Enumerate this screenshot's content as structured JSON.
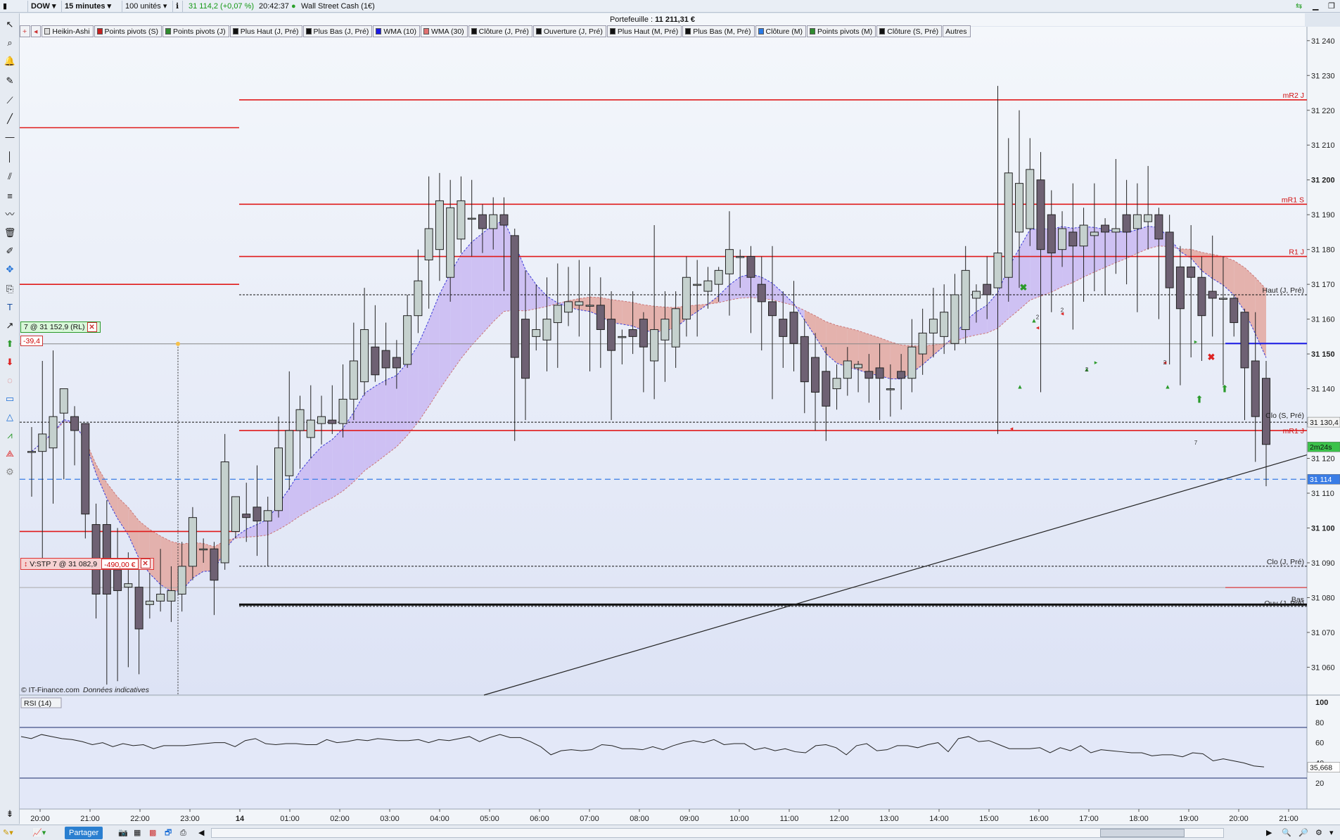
{
  "topbar": {
    "symbol": "DOW",
    "timeframe": "15 minutes",
    "quantity": "100 unités",
    "price": "31 114,2 (+0,07 %)",
    "time": "20:42:37",
    "instrument": "Wall Street Cash (1€)"
  },
  "portfolio": {
    "label": "Portefeuille :",
    "value": "11 211,31 €"
  },
  "indicators": [
    {
      "label": "Heikin-Ashi",
      "color": "#dddddd"
    },
    {
      "label": "Points pivots (S)",
      "color": "#c62020"
    },
    {
      "label": "Points pivots (J)",
      "color": "#2e8b2e"
    },
    {
      "label": "Plus Haut (J, Pré)",
      "color": "#111111"
    },
    {
      "label": "Plus Bas (J, Pré)",
      "color": "#111111"
    },
    {
      "label": "WMA (10)",
      "color": "#1a1ae6"
    },
    {
      "label": "WMA (30)",
      "color": "#e07070"
    },
    {
      "label": "Clôture (J, Pré)",
      "color": "#111111"
    },
    {
      "label": "Ouverture (J, Pré)",
      "color": "#111111"
    },
    {
      "label": "Plus Haut (M, Pré)",
      "color": "#111111"
    },
    {
      "label": "Plus Bas (M, Pré)",
      "color": "#111111"
    },
    {
      "label": "Clôture (M)",
      "color": "#2a7ae6"
    },
    {
      "label": "Points pivots (M)",
      "color": "#2e8b2e"
    },
    {
      "label": "Clôture (S, Pré)",
      "color": "#111111"
    },
    {
      "label": "Autres",
      "color": ""
    }
  ],
  "order": {
    "label": "7 @ 31 152,9 (RL)",
    "pnl": "-39,4"
  },
  "stop": {
    "label": "V:STP 7 @ 31 082,9",
    "value": "-490,00 €"
  },
  "copyright": "© IT-Finance.com",
  "disclaimer": "Données indicatives",
  "rsi": {
    "label": "RSI (14)",
    "value": "35,668",
    "ticks": [
      "100",
      "80",
      "60",
      "40",
      "20"
    ]
  },
  "price_labels": {
    "last": "31 114",
    "clo_s": "31 130,4",
    "countdown": "2m24s"
  },
  "level_labels": [
    "mR2 J",
    "mR1 S",
    "R1 J",
    "Haut (J, Pré)",
    "Clo (S, Pré)",
    "mR1 J",
    "Clo (J, Pré)",
    "Ouv (J, Pré)",
    "Bas"
  ],
  "marker_labels": [
    "2",
    "2",
    "2",
    "2",
    "7"
  ],
  "bottombar": {
    "share": "Partager"
  },
  "colors": {
    "bull": "#c5d1ce",
    "bear": "#6e6173",
    "wma10": "#3b3bd8",
    "up_fill": "#c9b8f2",
    "down_fill": "#e3a7a0",
    "red_level": "#e01a1a",
    "bg": "#e8eef8"
  },
  "chart_data": {
    "type": "candlestick",
    "x_ticks": [
      "20:00",
      "21:00",
      "22:00",
      "23:00",
      "14",
      "01:00",
      "02:00",
      "03:00",
      "04:00",
      "05:00",
      "06:00",
      "07:00",
      "08:00",
      "09:00",
      "10:00",
      "11:00",
      "12:00",
      "13:00",
      "14:00",
      "15:00",
      "16:00",
      "17:00",
      "18:00",
      "19:00",
      "20:00",
      "21:00"
    ],
    "y_ticks": [
      31060,
      31070,
      31080,
      31090,
      31100,
      31110,
      31120,
      31130,
      31140,
      31150,
      31160,
      31170,
      31180,
      31190,
      31200,
      31210,
      31220,
      31230,
      31240
    ],
    "ylim": [
      31052,
      31244
    ],
    "candles": [
      {
        "t": "19:45",
        "o": 31122,
        "h": 31129,
        "l": 31109,
        "c": 31122
      },
      {
        "t": "20:00",
        "o": 31122,
        "h": 31148,
        "l": 31090,
        "c": 31127
      },
      {
        "t": "20:15",
        "o": 31123,
        "h": 31151,
        "l": 31107,
        "c": 31132
      },
      {
        "t": "20:30",
        "o": 31133,
        "h": 31140,
        "l": 31114,
        "c": 31140
      },
      {
        "t": "20:45",
        "o": 31132,
        "h": 31135,
        "l": 31118,
        "c": 31128
      },
      {
        "t": "21:00",
        "o": 31130,
        "h": 31130,
        "l": 31097,
        "c": 31104
      },
      {
        "t": "21:15",
        "o": 31101,
        "h": 31107,
        "l": 31074,
        "c": 31081
      },
      {
        "t": "21:30",
        "o": 31101,
        "h": 31108,
        "l": 31055,
        "c": 31081
      },
      {
        "t": "21:45",
        "o": 31088,
        "h": 31100,
        "l": 31056,
        "c": 31082
      },
      {
        "t": "22:00",
        "o": 31083,
        "h": 31093,
        "l": 31060,
        "c": 31084
      },
      {
        "t": "22:15",
        "o": 31083,
        "h": 31091,
        "l": 31058,
        "c": 31071
      },
      {
        "t": "22:30",
        "o": 31078,
        "h": 31087,
        "l": 31074,
        "c": 31079
      },
      {
        "t": "22:45",
        "o": 31079,
        "h": 31094,
        "l": 31076,
        "c": 31081
      },
      {
        "t": "23:00",
        "o": 31079,
        "h": 31089,
        "l": 31073,
        "c": 31082
      },
      {
        "t": "23:15",
        "o": 31081,
        "h": 31096,
        "l": 31076,
        "c": 31089
      },
      {
        "t": "23:30",
        "o": 31089,
        "h": 31106,
        "l": 31085,
        "c": 31103
      },
      {
        "t": "23:45",
        "o": 31094,
        "h": 31097,
        "l": 31090,
        "c": 31094
      },
      {
        "t": "00:00",
        "o": 31094,
        "h": 31096,
        "l": 31075,
        "c": 31085
      },
      {
        "t": "00:15",
        "o": 31090,
        "h": 31127,
        "l": 31088,
        "c": 31119
      },
      {
        "t": "00:30",
        "o": 31099,
        "h": 31109,
        "l": 31097,
        "c": 31109
      },
      {
        "t": "00:45",
        "o": 31104,
        "h": 31113,
        "l": 31096,
        "c": 31103
      },
      {
        "t": "01:00",
        "o": 31106,
        "h": 31118,
        "l": 31092,
        "c": 31102
      },
      {
        "t": "01:15",
        "o": 31102,
        "h": 31109,
        "l": 31089,
        "c": 31105
      },
      {
        "t": "01:30",
        "o": 31105,
        "h": 31132,
        "l": 31103,
        "c": 31123
      },
      {
        "t": "01:45",
        "o": 31115,
        "h": 31145,
        "l": 31111,
        "c": 31128
      },
      {
        "t": "02:00",
        "o": 31128,
        "h": 31138,
        "l": 31117,
        "c": 31134
      },
      {
        "t": "02:15",
        "o": 31126,
        "h": 31141,
        "l": 31120,
        "c": 31131
      },
      {
        "t": "02:30",
        "o": 31130,
        "h": 31138,
        "l": 31124,
        "c": 31132
      },
      {
        "t": "02:45",
        "o": 31131,
        "h": 31141,
        "l": 31127,
        "c": 31130
      },
      {
        "t": "03:00",
        "o": 31130,
        "h": 31147,
        "l": 31126,
        "c": 31137
      },
      {
        "t": "03:15",
        "o": 31137,
        "h": 31159,
        "l": 31131,
        "c": 31148
      },
      {
        "t": "03:30",
        "o": 31142,
        "h": 31169,
        "l": 31138,
        "c": 31157
      },
      {
        "t": "03:45",
        "o": 31152,
        "h": 31164,
        "l": 31142,
        "c": 31144
      },
      {
        "t": "04:00",
        "o": 31151,
        "h": 31159,
        "l": 31141,
        "c": 31146
      },
      {
        "t": "04:15",
        "o": 31149,
        "h": 31154,
        "l": 31140,
        "c": 31146
      },
      {
        "t": "04:30",
        "o": 31147,
        "h": 31167,
        "l": 31146,
        "c": 31161
      },
      {
        "t": "04:45",
        "o": 31161,
        "h": 31180,
        "l": 31156,
        "c": 31171
      },
      {
        "t": "05:00",
        "o": 31177,
        "h": 31201,
        "l": 31163,
        "c": 31186
      },
      {
        "t": "05:15",
        "o": 31180,
        "h": 31202,
        "l": 31171,
        "c": 31194
      },
      {
        "t": "05:30",
        "o": 31172,
        "h": 31200,
        "l": 31165,
        "c": 31192
      },
      {
        "t": "05:45",
        "o": 31183,
        "h": 31201,
        "l": 31179,
        "c": 31194
      },
      {
        "t": "06:00",
        "o": 31189,
        "h": 31200,
        "l": 31178,
        "c": 31189
      },
      {
        "t": "06:15",
        "o": 31190,
        "h": 31193,
        "l": 31179,
        "c": 31186
      },
      {
        "t": "06:30",
        "o": 31186,
        "h": 31195,
        "l": 31180,
        "c": 31190
      },
      {
        "t": "06:45",
        "o": 31190,
        "h": 31195,
        "l": 31168,
        "c": 31187
      },
      {
        "t": "07:00",
        "o": 31184,
        "h": 31186,
        "l": 31125,
        "c": 31149
      },
      {
        "t": "07:15",
        "o": 31160,
        "h": 31174,
        "l": 31131,
        "c": 31143
      },
      {
        "t": "07:30",
        "o": 31155,
        "h": 31170,
        "l": 31151,
        "c": 31157
      },
      {
        "t": "07:45",
        "o": 31154,
        "h": 31172,
        "l": 31145,
        "c": 31160
      },
      {
        "t": "08:00",
        "o": 31159,
        "h": 31176,
        "l": 31146,
        "c": 31164
      },
      {
        "t": "08:15",
        "o": 31162,
        "h": 31175,
        "l": 31158,
        "c": 31165
      },
      {
        "t": "08:30",
        "o": 31164,
        "h": 31177,
        "l": 31155,
        "c": 31165
      },
      {
        "t": "08:45",
        "o": 31164,
        "h": 31175,
        "l": 31145,
        "c": 31164
      },
      {
        "t": "09:00",
        "o": 31164,
        "h": 31172,
        "l": 31146,
        "c": 31157
      },
      {
        "t": "09:15",
        "o": 31160,
        "h": 31168,
        "l": 31131,
        "c": 31151
      },
      {
        "t": "09:30",
        "o": 31155,
        "h": 31157,
        "l": 31147,
        "c": 31155
      },
      {
        "t": "09:45",
        "o": 31157,
        "h": 31168,
        "l": 31150,
        "c": 31155
      },
      {
        "t": "10:00",
        "o": 31160,
        "h": 31162,
        "l": 31139,
        "c": 31152
      },
      {
        "t": "10:15",
        "o": 31148,
        "h": 31187,
        "l": 31137,
        "c": 31157
      },
      {
        "t": "10:30",
        "o": 31154,
        "h": 31168,
        "l": 31142,
        "c": 31160
      },
      {
        "t": "10:45",
        "o": 31152,
        "h": 31168,
        "l": 31146,
        "c": 31163
      },
      {
        "t": "11:00",
        "o": 31160,
        "h": 31178,
        "l": 31155,
        "c": 31172
      },
      {
        "t": "11:15",
        "o": 31170,
        "h": 31177,
        "l": 31155,
        "c": 31170
      },
      {
        "t": "11:30",
        "o": 31168,
        "h": 31175,
        "l": 31163,
        "c": 31171
      },
      {
        "t": "11:45",
        "o": 31170,
        "h": 31175,
        "l": 31165,
        "c": 31174
      },
      {
        "t": "12:00",
        "o": 31173,
        "h": 31191,
        "l": 31161,
        "c": 31180
      },
      {
        "t": "12:15",
        "o": 31178,
        "h": 31180,
        "l": 31169,
        "c": 31178
      },
      {
        "t": "12:30",
        "o": 31178,
        "h": 31181,
        "l": 31156,
        "c": 31172
      },
      {
        "t": "12:45",
        "o": 31170,
        "h": 31178,
        "l": 31151,
        "c": 31165
      },
      {
        "t": "13:00",
        "o": 31165,
        "h": 31181,
        "l": 31137,
        "c": 31161
      },
      {
        "t": "13:15",
        "o": 31160,
        "h": 31168,
        "l": 31146,
        "c": 31155
      },
      {
        "t": "13:30",
        "o": 31162,
        "h": 31171,
        "l": 31145,
        "c": 31153
      },
      {
        "t": "13:45",
        "o": 31155,
        "h": 31160,
        "l": 31133,
        "c": 31142
      },
      {
        "t": "14:00",
        "o": 31149,
        "h": 31156,
        "l": 31128,
        "c": 31139
      },
      {
        "t": "14:15",
        "o": 31145,
        "h": 31152,
        "l": 31125,
        "c": 31135
      },
      {
        "t": "14:30",
        "o": 31140,
        "h": 31147,
        "l": 31134,
        "c": 31143
      },
      {
        "t": "14:45",
        "o": 31143,
        "h": 31152,
        "l": 31138,
        "c": 31148
      },
      {
        "t": "15:00",
        "o": 31146,
        "h": 31148,
        "l": 31139,
        "c": 31147
      },
      {
        "t": "15:15",
        "o": 31145,
        "h": 31150,
        "l": 31136,
        "c": 31143
      },
      {
        "t": "15:30",
        "o": 31146,
        "h": 31153,
        "l": 31131,
        "c": 31143
      },
      {
        "t": "15:45",
        "o": 31140,
        "h": 31147,
        "l": 31132,
        "c": 31140
      },
      {
        "t": "16:00",
        "o": 31145,
        "h": 31150,
        "l": 31134,
        "c": 31143
      },
      {
        "t": "16:15",
        "o": 31143,
        "h": 31160,
        "l": 31139,
        "c": 31152
      },
      {
        "t": "16:30",
        "o": 31150,
        "h": 31163,
        "l": 31144,
        "c": 31156
      },
      {
        "t": "16:45",
        "o": 31156,
        "h": 31169,
        "l": 31149,
        "c": 31160
      },
      {
        "t": "17:00",
        "o": 31155,
        "h": 31170,
        "l": 31150,
        "c": 31162
      },
      {
        "t": "17:15",
        "o": 31153,
        "h": 31173,
        "l": 31151,
        "c": 31167
      },
      {
        "t": "17:30",
        "o": 31157,
        "h": 31181,
        "l": 31153,
        "c": 31174
      },
      {
        "t": "17:45",
        "o": 31166,
        "h": 31170,
        "l": 31159,
        "c": 31168
      },
      {
        "t": "18:00",
        "o": 31170,
        "h": 31178,
        "l": 31160,
        "c": 31167
      },
      {
        "t": "18:15",
        "o": 31169,
        "h": 31227,
        "l": 31127,
        "c": 31179
      },
      {
        "t": "18:30",
        "o": 31172,
        "h": 31212,
        "l": 31165,
        "c": 31202
      },
      {
        "t": "18:45",
        "o": 31185,
        "h": 31220,
        "l": 31169,
        "c": 31199
      },
      {
        "t": "19:00",
        "o": 31186,
        "h": 31212,
        "l": 31181,
        "c": 31203
      },
      {
        "t": "19:15",
        "o": 31200,
        "h": 31208,
        "l": 31139,
        "c": 31180
      },
      {
        "t": "19:30",
        "o": 31190,
        "h": 31197,
        "l": 31162,
        "c": 31179
      },
      {
        "t": "19:45",
        "o": 31180,
        "h": 31191,
        "l": 31175,
        "c": 31186
      },
      {
        "t": "20:00",
        "o": 31185,
        "h": 31199,
        "l": 31157,
        "c": 31181
      },
      {
        "t": "20:15",
        "o": 31181,
        "h": 31192,
        "l": 31165,
        "c": 31187
      },
      {
        "t": "20:30",
        "o": 31184,
        "h": 31199,
        "l": 31168,
        "c": 31185
      },
      {
        "t": "20:45",
        "o": 31187,
        "h": 31189,
        "l": 31167,
        "c": 31185
      },
      {
        "t": "21:00",
        "o": 31185,
        "h": 31206,
        "l": 31173,
        "c": 31186
      },
      {
        "t": "21:15",
        "o": 31190,
        "h": 31200,
        "l": 31170,
        "c": 31185
      },
      {
        "t": "21:30",
        "o": 31186,
        "h": 31199,
        "l": 31162,
        "c": 31190
      },
      {
        "t": "21:45",
        "o": 31188,
        "h": 31204,
        "l": 31180,
        "c": 31190
      },
      {
        "t": "22:00",
        "o": 31190,
        "h": 31192,
        "l": 31160,
        "c": 31183
      },
      {
        "t": "22:15",
        "o": 31185,
        "h": 31190,
        "l": 31147,
        "c": 31169
      },
      {
        "t": "22:30",
        "o": 31175,
        "h": 31181,
        "l": 31141,
        "c": 31163
      },
      {
        "t": "22:45",
        "o": 31175,
        "h": 31187,
        "l": 31149,
        "c": 31172
      },
      {
        "t": "23:00",
        "o": 31172,
        "h": 31178,
        "l": 31148,
        "c": 31161
      },
      {
        "t": "23:15",
        "o": 31168,
        "h": 31184,
        "l": 31155,
        "c": 31166
      },
      {
        "t": "23:30",
        "o": 31166,
        "h": 31178,
        "l": 31141,
        "c": 31166
      },
      {
        "t": "23:45",
        "o": 31166,
        "h": 31167,
        "l": 31155,
        "c": 31159
      },
      {
        "t": "00:00",
        "o": 31162,
        "h": 31163,
        "l": 31131,
        "c": 31146
      },
      {
        "t": "00:15",
        "o": 31148,
        "h": 31162,
        "l": 31119,
        "c": 31132
      },
      {
        "t": "00:30",
        "o": 31143,
        "h": 31148,
        "l": 31112,
        "c": 31124
      }
    ],
    "levels": [
      {
        "name": "mR2 J",
        "value": 31223,
        "color": "#e01a1a",
        "style": "solid"
      },
      {
        "name": "mR1 S",
        "value": 31193,
        "color": "#e01a1a",
        "style": "solid"
      },
      {
        "name": "R1 J",
        "value": 31178,
        "color": "#e01a1a",
        "style": "solid"
      },
      {
        "name": "Haut (J, Pré)",
        "value": 31167,
        "color": "#111111",
        "style": "dashed"
      },
      {
        "name": "Clo (S, Pré)",
        "value": 31130.4,
        "color": "#111111",
        "style": "dashed"
      },
      {
        "name": "mR1 J",
        "value": 31128,
        "color": "#e01a1a",
        "style": "solid"
      },
      {
        "name": "Clo (J, Pré)",
        "value": 31089,
        "color": "#111111",
        "style": "dashed"
      },
      {
        "name": "Ouv (J, Pré)",
        "value": 31077.5,
        "color": "#111111",
        "style": "dashed"
      },
      {
        "name": "Bas",
        "value": 31078,
        "color": "#111111",
        "style": "solid"
      }
    ],
    "trendline": [
      {
        "x": "03:00",
        "y": 31040
      },
      {
        "x": "21:00",
        "y": 31121
      }
    ],
    "rsi": [
      66,
      64,
      68,
      66,
      64,
      63,
      61,
      58,
      60,
      56,
      59,
      57,
      58,
      54,
      57,
      57,
      57,
      58,
      59,
      60,
      60,
      56,
      62,
      64,
      59,
      58,
      59,
      59,
      58,
      58,
      63,
      60,
      61,
      63,
      62,
      64,
      63,
      62,
      62,
      63,
      60,
      63,
      62,
      64,
      66,
      61,
      65,
      68,
      65,
      65,
      61,
      56,
      48,
      52,
      53,
      52,
      53,
      58,
      57,
      54,
      54,
      53,
      56,
      53,
      57,
      60,
      62,
      60,
      63,
      58,
      59,
      59,
      53,
      55,
      52,
      54,
      51,
      50,
      57,
      58,
      55,
      48,
      57,
      59,
      52,
      53,
      57,
      57,
      55,
      58,
      60,
      51,
      64,
      66,
      61,
      62,
      58,
      54,
      54,
      54,
      55,
      50,
      55,
      52,
      57,
      50,
      53,
      52,
      51,
      50,
      50,
      47,
      48,
      48,
      46,
      50,
      49,
      42,
      44,
      42,
      40,
      37,
      36
    ]
  }
}
